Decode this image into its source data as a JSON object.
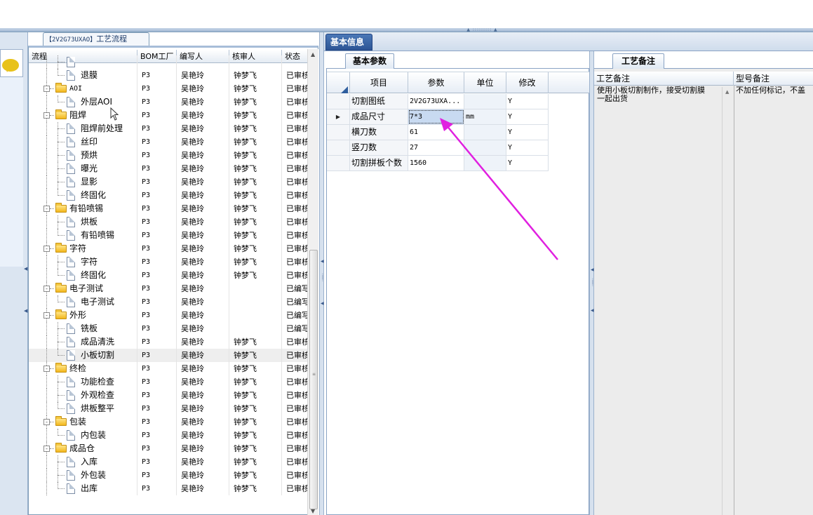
{
  "process_tab": {
    "code": "【2V2G73UXAO】",
    "title": "工艺流程"
  },
  "process_grid": {
    "headers": [
      "流程",
      "BOM工厂",
      "编写人",
      "核审人",
      "状态"
    ],
    "rows": [
      {
        "name": "",
        "level": 1,
        "type": "doc",
        "bom": "",
        "writer": "",
        "checker": "",
        "status": ""
      },
      {
        "name": "退膜",
        "level": 1,
        "type": "doc",
        "bom": "P3",
        "writer": "吴艳玲",
        "checker": "钟梦飞",
        "status": "已审核"
      },
      {
        "name": "AOI",
        "level": 0,
        "type": "folder",
        "bom": "P3",
        "writer": "吴艳玲",
        "checker": "钟梦飞",
        "status": "已审核"
      },
      {
        "name": "外层AOI",
        "level": 1,
        "type": "doc",
        "bom": "P3",
        "writer": "吴艳玲",
        "checker": "钟梦飞",
        "status": "已审核"
      },
      {
        "name": "阻焊",
        "level": 0,
        "type": "folder",
        "bom": "P3",
        "writer": "吴艳玲",
        "checker": "钟梦飞",
        "status": "已审核"
      },
      {
        "name": "阻焊前处理",
        "level": 1,
        "type": "doc",
        "bom": "P3",
        "writer": "吴艳玲",
        "checker": "钟梦飞",
        "status": "已审核"
      },
      {
        "name": "丝印",
        "level": 1,
        "type": "doc",
        "bom": "P3",
        "writer": "吴艳玲",
        "checker": "钟梦飞",
        "status": "已审核"
      },
      {
        "name": "预烘",
        "level": 1,
        "type": "doc",
        "bom": "P3",
        "writer": "吴艳玲",
        "checker": "钟梦飞",
        "status": "已审核"
      },
      {
        "name": "曝光",
        "level": 1,
        "type": "doc",
        "bom": "P3",
        "writer": "吴艳玲",
        "checker": "钟梦飞",
        "status": "已审核"
      },
      {
        "name": "显影",
        "level": 1,
        "type": "doc",
        "bom": "P3",
        "writer": "吴艳玲",
        "checker": "钟梦飞",
        "status": "已审核"
      },
      {
        "name": "终固化",
        "level": 1,
        "type": "doc",
        "bom": "P3",
        "writer": "吴艳玲",
        "checker": "钟梦飞",
        "status": "已审核"
      },
      {
        "name": "有铅喷锡",
        "level": 0,
        "type": "folder",
        "bom": "P3",
        "writer": "吴艳玲",
        "checker": "钟梦飞",
        "status": "已审核"
      },
      {
        "name": "烘板",
        "level": 1,
        "type": "doc",
        "bom": "P3",
        "writer": "吴艳玲",
        "checker": "钟梦飞",
        "status": "已审核"
      },
      {
        "name": "有铅喷锡",
        "level": 1,
        "type": "doc",
        "bom": "P3",
        "writer": "吴艳玲",
        "checker": "钟梦飞",
        "status": "已审核"
      },
      {
        "name": "字符",
        "level": 0,
        "type": "folder",
        "bom": "P3",
        "writer": "吴艳玲",
        "checker": "钟梦飞",
        "status": "已审核"
      },
      {
        "name": "字符",
        "level": 1,
        "type": "doc",
        "bom": "P3",
        "writer": "吴艳玲",
        "checker": "钟梦飞",
        "status": "已审核"
      },
      {
        "name": "终固化",
        "level": 1,
        "type": "doc",
        "bom": "P3",
        "writer": "吴艳玲",
        "checker": "钟梦飞",
        "status": "已审核"
      },
      {
        "name": "电子测试",
        "level": 0,
        "type": "folder",
        "bom": "P3",
        "writer": "吴艳玲",
        "checker": "",
        "status": "已编写"
      },
      {
        "name": "电子测试",
        "level": 1,
        "type": "doc",
        "bom": "P3",
        "writer": "吴艳玲",
        "checker": "",
        "status": "已编写"
      },
      {
        "name": "外形",
        "level": 0,
        "type": "folder",
        "bom": "P3",
        "writer": "吴艳玲",
        "checker": "",
        "status": "已编写"
      },
      {
        "name": "铣板",
        "level": 1,
        "type": "doc",
        "bom": "P3",
        "writer": "吴艳玲",
        "checker": "",
        "status": "已编写"
      },
      {
        "name": "成品清洗",
        "level": 1,
        "type": "doc",
        "bom": "P3",
        "writer": "吴艳玲",
        "checker": "钟梦飞",
        "status": "已审核"
      },
      {
        "name": "小板切割",
        "level": 1,
        "type": "doc",
        "bom": "P3",
        "writer": "吴艳玲",
        "checker": "钟梦飞",
        "status": "已审核",
        "selected": true
      },
      {
        "name": "终检",
        "level": 0,
        "type": "folder",
        "bom": "P3",
        "writer": "吴艳玲",
        "checker": "钟梦飞",
        "status": "已审核"
      },
      {
        "name": "功能检查",
        "level": 1,
        "type": "doc",
        "bom": "P3",
        "writer": "吴艳玲",
        "checker": "钟梦飞",
        "status": "已审核"
      },
      {
        "name": "外观检查",
        "level": 1,
        "type": "doc",
        "bom": "P3",
        "writer": "吴艳玲",
        "checker": "钟梦飞",
        "status": "已审核"
      },
      {
        "name": "烘板整平",
        "level": 1,
        "type": "doc",
        "bom": "P3",
        "writer": "吴艳玲",
        "checker": "钟梦飞",
        "status": "已审核"
      },
      {
        "name": "包装",
        "level": 0,
        "type": "folder",
        "bom": "P3",
        "writer": "吴艳玲",
        "checker": "钟梦飞",
        "status": "已审核"
      },
      {
        "name": "内包装",
        "level": 1,
        "type": "doc",
        "bom": "P3",
        "writer": "吴艳玲",
        "checker": "钟梦飞",
        "status": "已审核"
      },
      {
        "name": "成品仓",
        "level": 0,
        "type": "folder",
        "bom": "P3",
        "writer": "吴艳玲",
        "checker": "钟梦飞",
        "status": "已审核"
      },
      {
        "name": "入库",
        "level": 1,
        "type": "doc",
        "bom": "P3",
        "writer": "吴艳玲",
        "checker": "钟梦飞",
        "status": "已审核"
      },
      {
        "name": "外包装",
        "level": 1,
        "type": "doc",
        "bom": "P3",
        "writer": "吴艳玲",
        "checker": "钟梦飞",
        "status": "已审核"
      },
      {
        "name": "出库",
        "level": 1,
        "type": "doc",
        "bom": "P3",
        "writer": "吴艳玲",
        "checker": "钟梦飞",
        "status": "已审核"
      }
    ]
  },
  "info_tab": {
    "label": "基本信息"
  },
  "params_tab": {
    "label": "基本参数"
  },
  "params_grid": {
    "headers": [
      "项目",
      "参数",
      "单位",
      "修改"
    ],
    "rows": [
      {
        "item": "切割图纸",
        "param": "2V2G73UXA...",
        "unit": "",
        "edit": "Y"
      },
      {
        "item": "成品尺寸",
        "param": "7*3",
        "unit": "mm",
        "edit": "Y",
        "current": true
      },
      {
        "item": "横刀数",
        "param": "61",
        "unit": "",
        "edit": "Y"
      },
      {
        "item": "竖刀数",
        "param": "27",
        "unit": "",
        "edit": "Y"
      },
      {
        "item": "切割拼板个数",
        "param": "1560",
        "unit": "",
        "edit": "Y"
      }
    ]
  },
  "notes_tab": {
    "label": "工艺备注"
  },
  "notes_grid": {
    "headers": [
      "工艺备注",
      "型号备注"
    ],
    "process_note": "使用小板切割制作，接受切割膜\n一起出货",
    "model_note": "不加任何标记，不盖"
  },
  "colors": {
    "annotation_arrow": "#e020e0",
    "tab_active": "#2d5595"
  }
}
